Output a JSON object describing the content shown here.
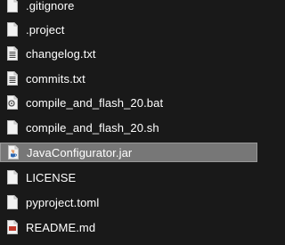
{
  "explorer": {
    "files": [
      {
        "name": ".gitignore",
        "icon": "blank-file-icon",
        "selected": false
      },
      {
        "name": ".project",
        "icon": "blank-file-icon",
        "selected": false
      },
      {
        "name": "changelog.txt",
        "icon": "text-file-icon",
        "selected": false
      },
      {
        "name": "commits.txt",
        "icon": "text-file-icon",
        "selected": false
      },
      {
        "name": "compile_and_flash_20.bat",
        "icon": "batch-file-icon",
        "selected": false
      },
      {
        "name": "compile_and_flash_20.sh",
        "icon": "blank-file-icon",
        "selected": false
      },
      {
        "name": "JavaConfigurator.jar",
        "icon": "java-jar-icon",
        "selected": true
      },
      {
        "name": "LICENSE",
        "icon": "blank-file-icon",
        "selected": false
      },
      {
        "name": "pyproject.toml",
        "icon": "blank-file-icon",
        "selected": false
      },
      {
        "name": "README.md",
        "icon": "markdown-file-icon",
        "selected": false
      }
    ],
    "colors": {
      "background": "#191919",
      "selection": "#777777",
      "text": "#ffffff"
    }
  }
}
